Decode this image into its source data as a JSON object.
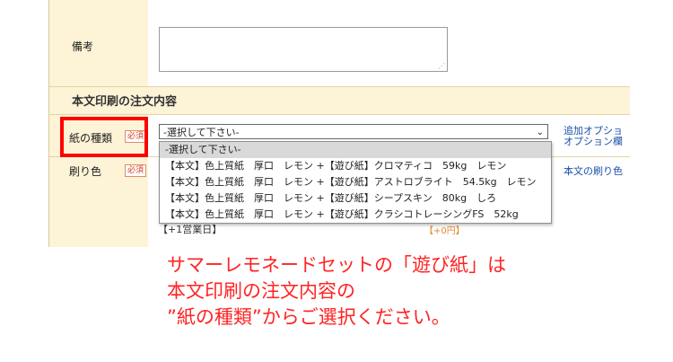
{
  "form": {
    "remarks_label": "備考",
    "section_title": "本文印刷の注文内容",
    "paper_label": "紙の種類",
    "print_color_label": "刷り色",
    "required_badge": "必須",
    "paper_select_value": "-選択して下さい-",
    "options": [
      "-選択して下さい-",
      "【本文】色上質紙　厚口　レモン +【遊び紙】クロマティコ　59kg　レモン",
      "【本文】色上質紙　厚口　レモン +【遊び紙】アストロブライト　54.5kg　レモン",
      "【本文】色上質紙　厚口　レモン +【遊び紙】シープスキン　80kg　しろ",
      "【本文】色上質紙　厚口　レモン +【遊び紙】クラシコトレーシングFS　52kg"
    ],
    "side_link_1": "追加オプショ",
    "side_link_2": "オプション欄",
    "side_link_3": "本文の刷り色",
    "business_day_note": "【+1営業日】",
    "price_note": "【+0円】"
  },
  "caption": {
    "line1": "サマーレモネードセットの「遊び紙」は",
    "line2": "本文印刷の注文内容の",
    "line3": "”紙の種類”からご選択ください。"
  },
  "colors": {
    "label_bg": "#fdf3d6",
    "highlight": "#ff0000",
    "caption": "#ff2323",
    "link": "#1a4fa8"
  }
}
